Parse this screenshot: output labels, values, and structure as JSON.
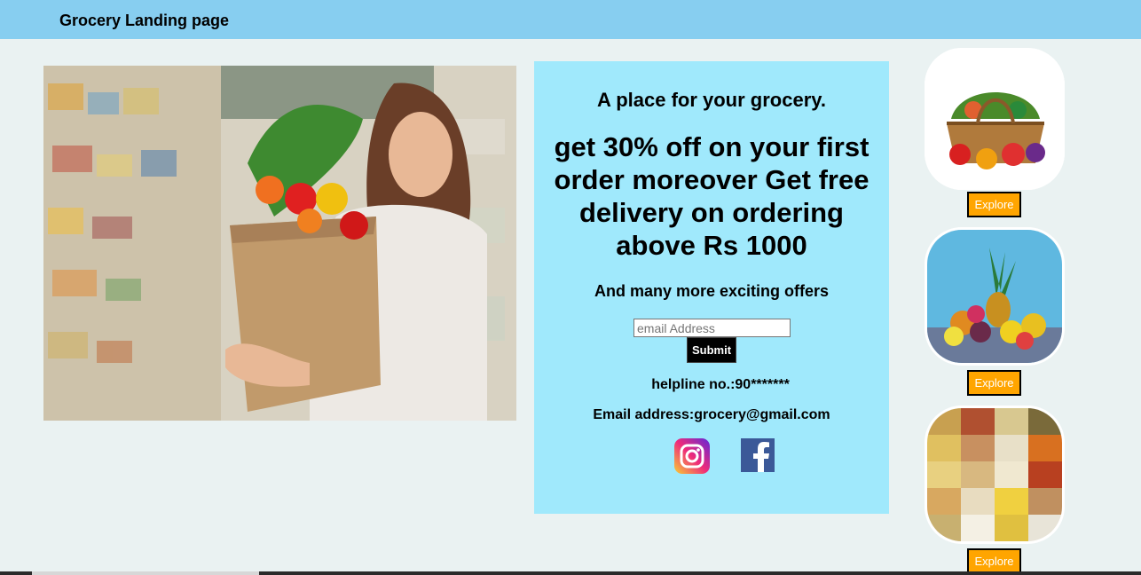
{
  "header": {
    "title": "Grocery Landing page"
  },
  "promo": {
    "tagline": "A place for your grocery.",
    "headline": "get 30% off on your first order moreover Get free delivery on ordering above Rs 1000",
    "offers": "And many more exciting offers",
    "email_placeholder": "email Address",
    "email_value": "",
    "submit_label": "Submit",
    "helpline": "helpline no.:90*******",
    "email_address": "Email address:grocery@gmail.com",
    "social": [
      "instagram-icon",
      "facebook-icon"
    ]
  },
  "cards": [
    {
      "image": "vegetable-basket-image",
      "button_label": "Explore"
    },
    {
      "image": "fruit-pile-image",
      "button_label": "Explore"
    },
    {
      "image": "grains-pulses-image",
      "button_label": "Explore"
    }
  ],
  "colors": {
    "header_bg": "#87cef0",
    "page_bg": "#eaf2f2",
    "promo_bg": "#a0e9fc",
    "explore_bg": "#ffa500",
    "submit_bg": "#000000"
  }
}
